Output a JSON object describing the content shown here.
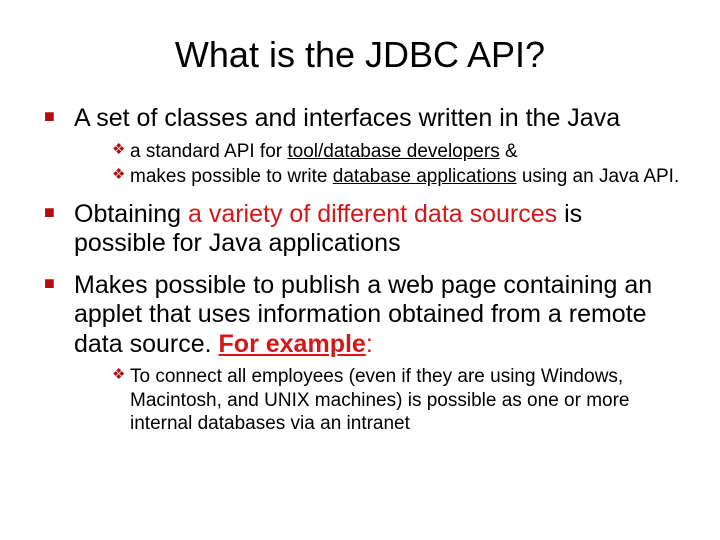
{
  "title": "What is the JDBC API?",
  "bullets": {
    "b1": {
      "text": "A set of classes and interfaces written in the Java",
      "sub": {
        "s1a": "a standard API for ",
        "s1b": "tool/database developers",
        "s1c": "   &",
        "s2a": "makes  possible to write  ",
        "s2b": "database applications",
        "s2c": " using an Java API."
      }
    },
    "b2": {
      "t1": "Obtaining  ",
      "t2": "a variety of different data sources",
      "t3": " is possible for Java applications"
    },
    "b3": {
      "t1": "Makes possible to publish a web page containing an applet that uses information obtained from a remote data source. ",
      "t2": "For example",
      "t3": ":",
      "sub": {
        "s1": "To connect all  employees (even if they are using  Windows, Macintosh, and UNIX machines) is possible as one or more internal databases via an intranet"
      }
    }
  }
}
